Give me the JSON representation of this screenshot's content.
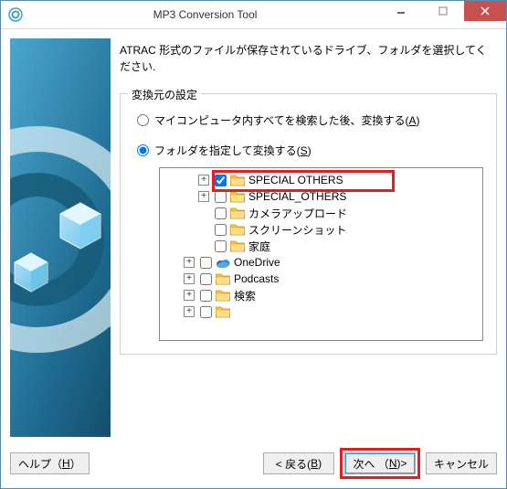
{
  "titlebar": {
    "title": "MP3 Conversion Tool"
  },
  "instruction": "ATRAC 形式のファイルが保存されているドライブ、フォルダを選択してください.",
  "fieldset_legend": "変換元の設定",
  "radio": {
    "search_all": {
      "label": "マイコンピュータ内すべてを検索した後、変換する(",
      "accel": "A",
      "tail": ")",
      "checked": false
    },
    "select_folder": {
      "label": "フォルダを指定して変換する(",
      "accel": "S",
      "tail": ")",
      "checked": true
    }
  },
  "tree": {
    "items": [
      {
        "indent": 40,
        "expander": "+",
        "checked": true,
        "icon": "folder",
        "label": "SPECIAL OTHERS",
        "highlight": true
      },
      {
        "indent": 40,
        "expander": "+",
        "checked": false,
        "icon": "folder",
        "label": "SPECIAL_OTHERS"
      },
      {
        "indent": 40,
        "expander": "",
        "checked": false,
        "icon": "folder",
        "label": "カメラアップロード"
      },
      {
        "indent": 40,
        "expander": "",
        "checked": false,
        "icon": "folder",
        "label": "スクリーンショット"
      },
      {
        "indent": 40,
        "expander": "",
        "checked": false,
        "icon": "folder",
        "label": "家庭"
      },
      {
        "indent": 24,
        "expander": "+",
        "checked": false,
        "icon": "onedrive",
        "label": "OneDrive"
      },
      {
        "indent": 24,
        "expander": "+",
        "checked": false,
        "icon": "folder",
        "label": "Podcasts"
      },
      {
        "indent": 24,
        "expander": "+",
        "checked": false,
        "icon": "folder",
        "label": "検索"
      },
      {
        "indent": 24,
        "expander": "+",
        "checked": false,
        "icon": "folder",
        "label": ""
      }
    ]
  },
  "buttons": {
    "help": {
      "pre": "ヘルプ（",
      "accel": "H",
      "post": "）"
    },
    "back": {
      "pre": "< 戻る(",
      "accel": "B",
      "post": ")"
    },
    "next": {
      "pre": "次へ （",
      "accel": "N",
      "post": ")>"
    },
    "cancel": {
      "label": "キャンセル"
    }
  }
}
